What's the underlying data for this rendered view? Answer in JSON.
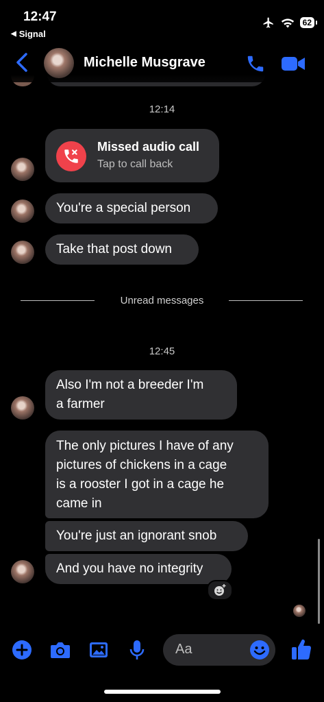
{
  "status_bar": {
    "time": "12:47",
    "back_app": "Signal",
    "battery": "62"
  },
  "header": {
    "contact_name": "Michelle Musgrave"
  },
  "colors": {
    "accent": "#2d6bff",
    "bubble": "#303033",
    "missed_call": "#f0424b"
  },
  "messages": {
    "ts1": "12:14",
    "missed_call_title": "Missed audio call",
    "missed_call_sub": "Tap to call back",
    "m1": "You're a special person",
    "m2": "Take that post down",
    "unread": "Unread messages",
    "ts2": "12:45",
    "m3_l1": "Also I'm not a breeder I'm",
    "m3_l2": "a farmer",
    "m4_l1": "The only pictures I have of any",
    "m4_l2": "pictures of chickens in a cage",
    "m4_l3": "is a rooster I got in a cage he",
    "m4_l4": "came in",
    "m5": "You're just an ignorant snob",
    "m6": "And you have no integrity"
  },
  "composer": {
    "placeholder": "Aa"
  },
  "icons": [
    "back-chevron-icon",
    "phone-icon",
    "video-camera-icon",
    "missed-call-icon",
    "add-icon",
    "camera-icon",
    "image-icon",
    "microphone-icon",
    "emoji-icon",
    "thumbs-up-icon",
    "reaction-emoji-icon",
    "airplane-icon",
    "wifi-icon",
    "battery-icon"
  ]
}
